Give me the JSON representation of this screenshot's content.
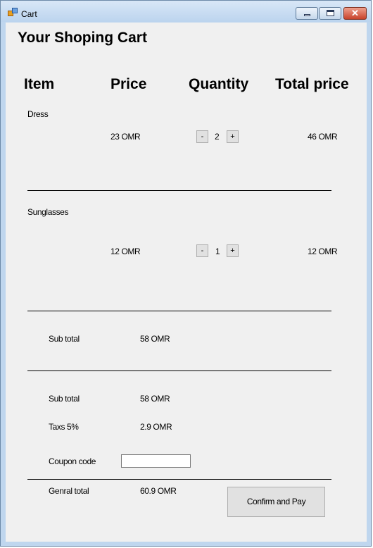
{
  "window": {
    "title": "Cart",
    "close_glyph": "✕"
  },
  "page": {
    "title": "Your Shoping Cart"
  },
  "columns": {
    "item": "Item",
    "price": "Price",
    "quantity": "Quantity",
    "total": "Total price"
  },
  "items": [
    {
      "name": "Dress",
      "price": "23 OMR",
      "quantity": "2",
      "total": "46 OMR",
      "minus": "-",
      "plus": "+"
    },
    {
      "name": "Sunglasses",
      "price": "12 OMR",
      "quantity": "1",
      "total": "12 OMR",
      "minus": "-",
      "plus": "+"
    }
  ],
  "summary": {
    "subtotal_label_1": "Sub total",
    "subtotal_value_1": "58 OMR",
    "subtotal_label_2": "Sub total",
    "subtotal_value_2": "58 OMR",
    "tax_label": "Taxs 5%",
    "tax_value": "2.9 OMR",
    "coupon_label": "Coupon code",
    "coupon_value": "",
    "general_label": "Genral total",
    "general_value": "60.9 OMR"
  },
  "actions": {
    "confirm_label": "Confirm and Pay"
  },
  "icons": {
    "app": "app-icon",
    "minimize": "minimize-icon",
    "maximize": "maximize-icon",
    "close": "close-icon"
  }
}
